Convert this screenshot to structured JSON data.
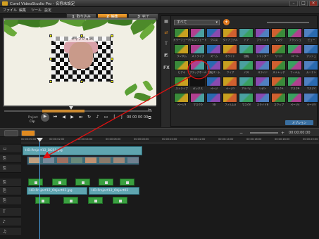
{
  "app": {
    "title": "Corel VideoStudio Pro - 名称未設定"
  },
  "window_controls": {
    "min": "–",
    "max": "□",
    "close": "×"
  },
  "menu": [
    "ファイル",
    "編集",
    "ツール",
    "設定"
  ],
  "steps": [
    {
      "num": "1",
      "label": "取り込み"
    },
    {
      "num": "2",
      "label": "編集"
    },
    {
      "num": "3",
      "label": "完了"
    }
  ],
  "preview": {
    "photo_title": "キャプション",
    "project_label": "Project",
    "clip_label": "Clip",
    "timecode": "00 00 00 00"
  },
  "library": {
    "category": "すべて",
    "add_label": "+",
    "thumb_labels": [
      "カラーフェード",
      "クロスフェード",
      "クロス",
      "ダイアゴナル",
      "ドア",
      "ブラインド",
      "マスク",
      "フラッシュ",
      "ビュー",
      "ランダム",
      "ストライプ",
      "ズーム",
      "ホワイト",
      "回転",
      "シャッター",
      "サイド",
      "ロール",
      "プッシュ",
      "ビデオ",
      "ブラックホール",
      "回転ズーム",
      "ワイプ",
      "パス",
      "スライド",
      "ストレッチ",
      "フィルム",
      "カーテン",
      "ストライプ",
      "ボックス",
      "ページ",
      "ページ2",
      "アルバム",
      "リボン",
      "マスクA",
      "マスクB",
      "マスクC",
      "ページ3",
      "マスクD",
      "3D",
      "フィルムA",
      "マスクE",
      "スライドB",
      "スワップ",
      "ページ4",
      "ページ5"
    ],
    "footer": "オプション"
  },
  "timeline": {
    "time": "00:00:00:00",
    "ruler": [
      "00:00:00:00",
      "00:00:02:00",
      "00:00:04:00",
      "00:00:06:00",
      "00:00:08:00",
      "00:00:10:00",
      "00:00:12:00",
      "00:00:14:00",
      "00:00:16:00",
      "00:00:18:00",
      "00:00:20:00"
    ],
    "clips": {
      "title_clip": "HD-Project12_BGR1.jpg",
      "overlay_a": "HD-Project12_Object02.jpg",
      "overlay_b": "HD-Project12_Object02"
    }
  },
  "colors": {
    "accent": "#e08a20",
    "clip": "#5fa5b0",
    "arrow": "#e01010"
  }
}
